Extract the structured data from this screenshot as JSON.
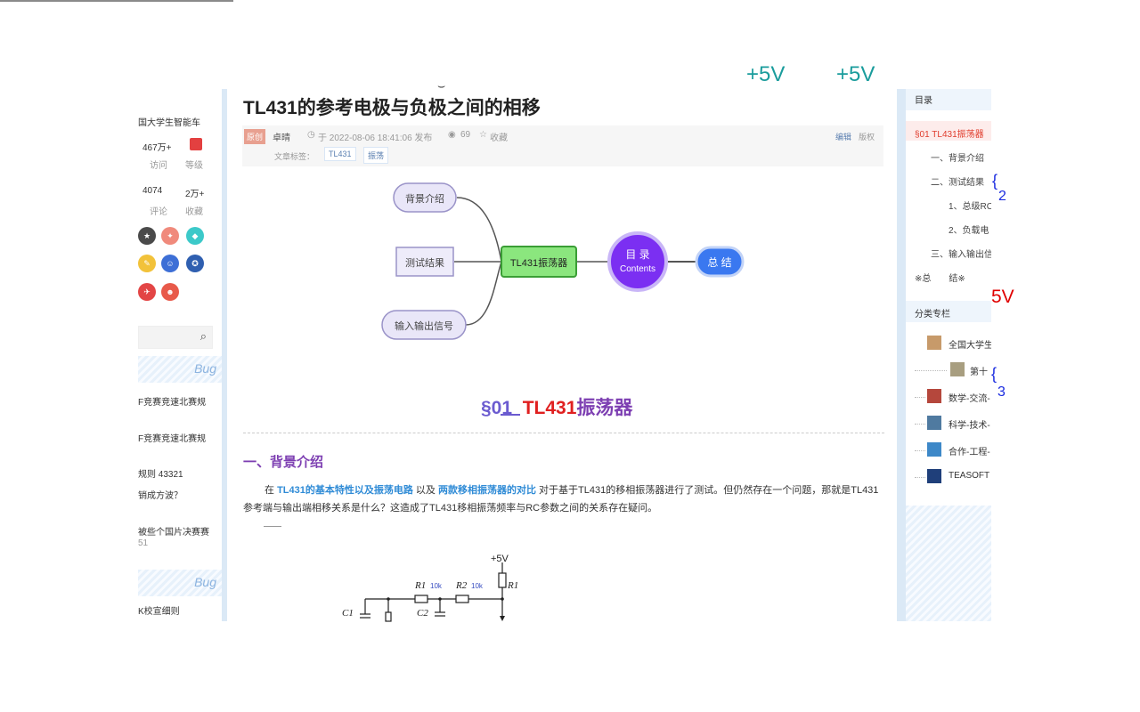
{
  "overlays": {
    "v1": "+5V",
    "v2": "+5V",
    "v3": "5V",
    "brace1": "2",
    "brace2": "3"
  },
  "left": {
    "name": "国大学生智能车",
    "stats": [
      {
        "value": "467万+",
        "label": "访问"
      },
      {
        "value": "",
        "label": "等级"
      },
      {
        "value": "4074",
        "label": "评论"
      },
      {
        "value": "2万+",
        "label": "收藏"
      }
    ],
    "hot_articles": [
      "F竞赛竞速北赛规",
      "F竞赛竞速北赛规",
      "规则 43321",
      "销成方波？",
      "被些个国片决赛赛",
      "51"
    ],
    "bottom": [
      "K校宣细则",
      "，，，，"
    ],
    "bug_label": "Bug"
  },
  "article": {
    "title": "TL431的参考电极与负极之间的相移",
    "type_badge": "原创",
    "author": "卓晴",
    "date": "于 2022-08-06 18:41:06 发布",
    "views": "69",
    "collect": "收藏",
    "edit": "编辑",
    "copyright": "版权",
    "tags_label": "文章标签：",
    "tags": [
      "TL431",
      "振荡"
    ],
    "mindmap": {
      "left_nodes": [
        "背景介绍",
        "测试结果",
        "输入输出信号"
      ],
      "center": "TL431振荡器",
      "toc_main": "目 录",
      "toc_sub": "Contents",
      "right": "总 结"
    },
    "section_num": "§01",
    "section_title_red": "TL431",
    "section_title_purple": "振荡器",
    "h1": "一、背景介绍",
    "para_prefix": "在 ",
    "link1": "TL431的基本特性以及振荡电路",
    "para_mid": " 以及 ",
    "link2": "两款移相振荡器的对比",
    "para_rest": " 对于基于TL431的移相振荡器进行了测试。但仍然存在一个问题，那就是TL431 参考端与输出端相移关系是什么？这造成了TL431移相振荡频率与RC参数之间的关系存在疑问。",
    "circuit": {
      "vcc": "+5V",
      "r1": "R1",
      "r1v": "10k",
      "r2": "R2",
      "r2v": "10k",
      "r3": "R1",
      "c1": "C1",
      "c2": "C2"
    }
  },
  "toc": {
    "title": "目录",
    "items": [
      "§01 TL431振荡器",
      "一、背景介绍",
      "二、测试结果",
      "1、总级RC",
      "2、负载电",
      "三、输入输出信",
      "※总　　结※"
    ]
  },
  "columns": {
    "title": "分类专栏",
    "items": [
      "全国大学生",
      "第十",
      "数学-交流-",
      "科学-技术-",
      "合作-工程-",
      "TEASOFT"
    ]
  },
  "colors": {
    "accent": "#2f8bd6",
    "purple": "#7d3fb2",
    "red": "#e02020"
  }
}
